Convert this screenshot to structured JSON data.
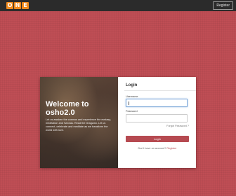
{
  "topbar": {
    "logo_letters": [
      "O",
      "N",
      "E"
    ],
    "register_label": "Register"
  },
  "hero": {
    "title_line1": "Welcome to",
    "title_line2": "osho2.0",
    "description": "Let us awaken the cosmos and experience the ecstasy, meditation and Sannas. Read the bhagwan. Let us connect, celebrate and meditate as we transform the world with love."
  },
  "form": {
    "title": "Login",
    "username_label": "Username",
    "username_value": "",
    "password_label": "Password",
    "password_value": "",
    "forgot_label": "Forgot Password ?",
    "login_label": "Login",
    "signup_text": "Don't have an account?",
    "signup_link": "Register"
  },
  "colors": {
    "background": "#bf4e55",
    "accent": "#b64a51",
    "logo": "#f08a1d",
    "topbar": "#2b2b2b"
  }
}
